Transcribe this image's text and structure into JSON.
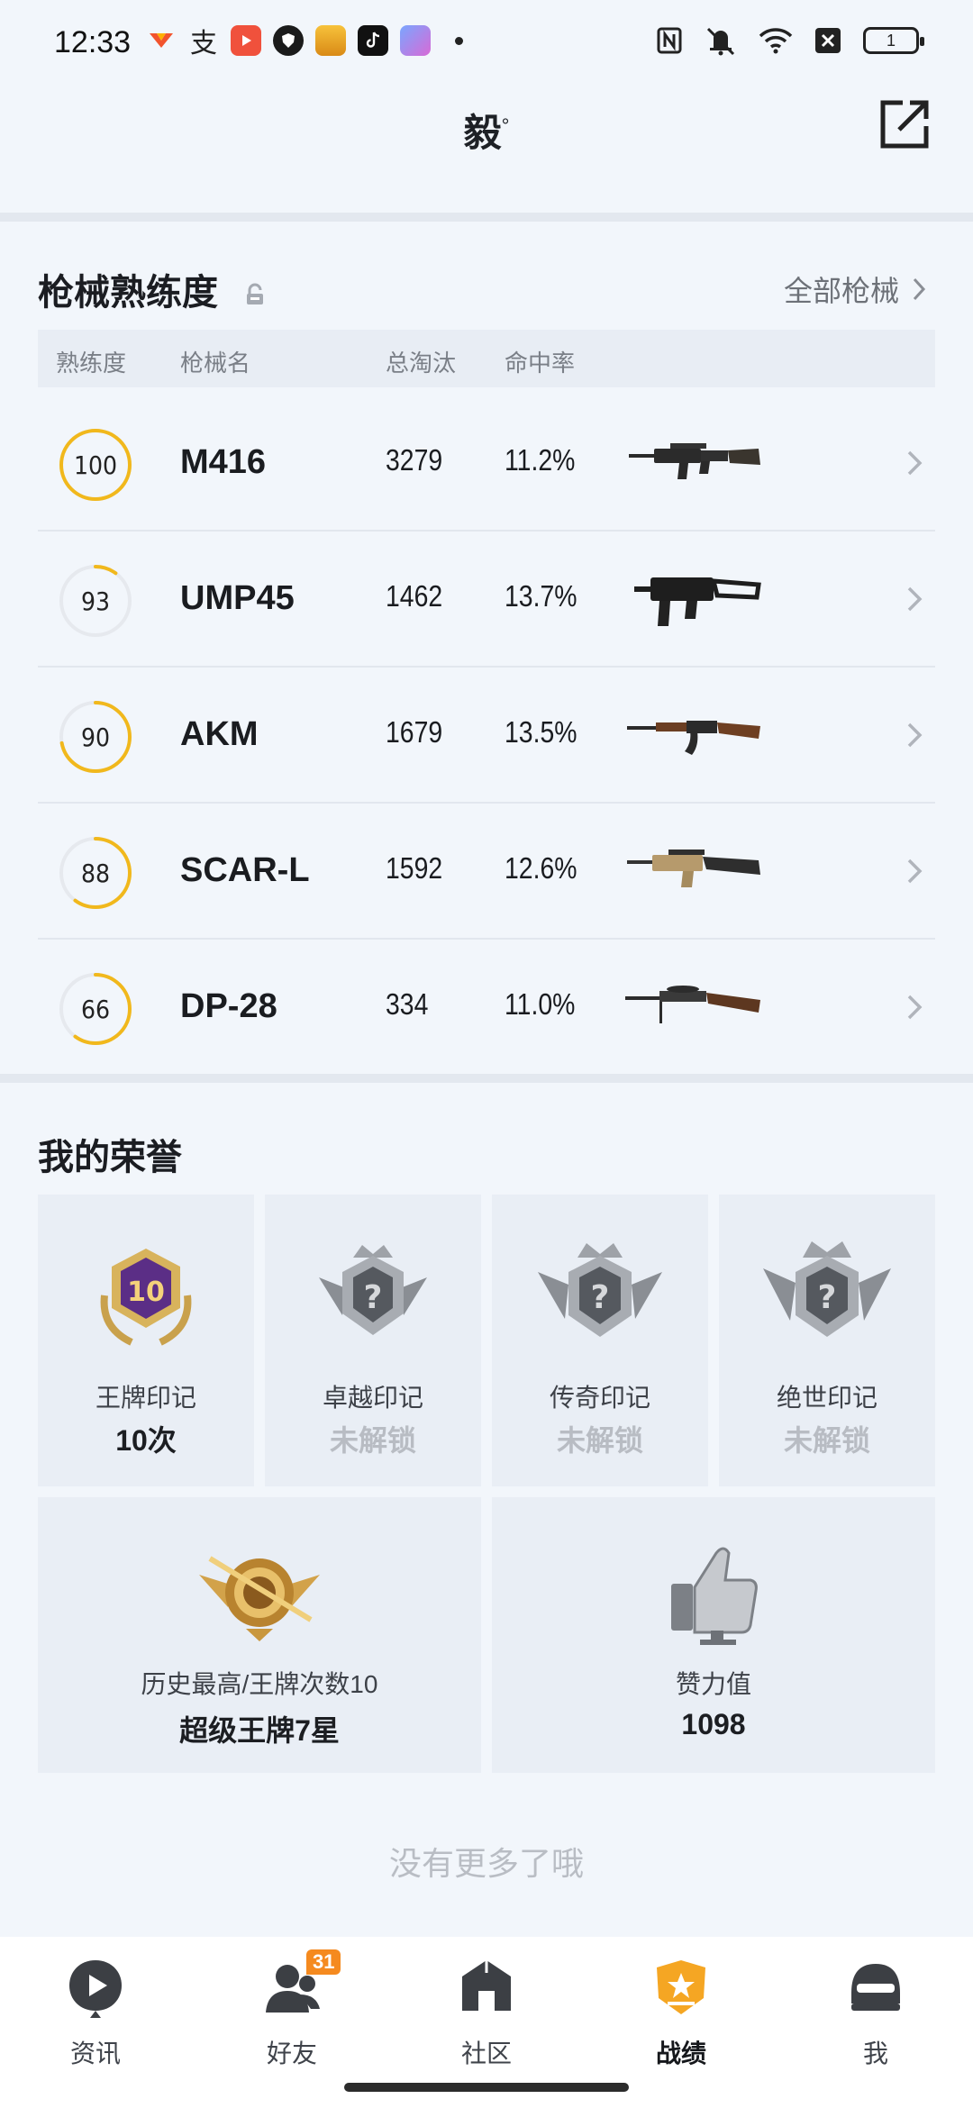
{
  "status_bar": {
    "time": "12:33",
    "battery": "1",
    "app_icons": [
      "app-store-icon",
      "alipay-icon",
      "video-icon",
      "shield-icon",
      "game-icon",
      "tiktok-icon",
      "game-avatar-icon"
    ],
    "system_icons": [
      "nfc-icon",
      "mute-icon",
      "wifi-icon",
      "x-box-icon",
      "battery-icon"
    ]
  },
  "header": {
    "title": "毅",
    "title_mark": "°",
    "share_icon": "share-external-icon"
  },
  "weapons": {
    "title": "枪械熟练度",
    "lock_icon": "lock-icon",
    "all_link": "全部枪械",
    "columns": [
      "熟练度",
      "枪械名",
      "总淘汰",
      "命中率"
    ],
    "accent_color": "#f1b81c",
    "rows": [
      {
        "proficiency": "100",
        "progress": 1.0,
        "name": "M416",
        "kills": "3279",
        "hit_rate": "11.2%",
        "image": "m416-rifle-image"
      },
      {
        "proficiency": "93",
        "progress": 0.1,
        "name": "UMP45",
        "kills": "1462",
        "hit_rate": "13.7%",
        "image": "ump45-smg-image"
      },
      {
        "proficiency": "90",
        "progress": 0.72,
        "name": "AKM",
        "kills": "1679",
        "hit_rate": "13.5%",
        "image": "akm-rifle-image"
      },
      {
        "proficiency": "88",
        "progress": 0.6,
        "name": "SCAR-L",
        "kills": "1592",
        "hit_rate": "12.6%",
        "image": "scar-l-rifle-image"
      },
      {
        "proficiency": "66",
        "progress": 0.6,
        "name": "DP-28",
        "kills": "334",
        "hit_rate": "11.0%",
        "image": "dp28-lmg-image"
      }
    ]
  },
  "honors": {
    "title": "我的荣誉",
    "marks": [
      {
        "label": "王牌印记",
        "value": "10次",
        "locked": false,
        "badge_number": "10"
      },
      {
        "label": "卓越印记",
        "value": "未解锁",
        "locked": true
      },
      {
        "label": "传奇印记",
        "value": "未解锁",
        "locked": true
      },
      {
        "label": "绝世印记",
        "value": "未解锁",
        "locked": true
      }
    ],
    "history": {
      "label": "历史最高/王牌次数10",
      "value": "超级王牌7星"
    },
    "likes": {
      "label": "赞力值",
      "value": "1098"
    }
  },
  "footer_text": "没有更多了哦",
  "bottom_nav": {
    "items": [
      {
        "label": "资讯",
        "icon": "news-play-icon",
        "active": false
      },
      {
        "label": "好友",
        "icon": "friends-icon",
        "active": false,
        "badge": "31"
      },
      {
        "label": "社区",
        "icon": "community-house-icon",
        "active": false
      },
      {
        "label": "战绩",
        "icon": "record-shield-icon",
        "active": true
      },
      {
        "label": "我",
        "icon": "helmet-icon",
        "active": false
      }
    ]
  }
}
